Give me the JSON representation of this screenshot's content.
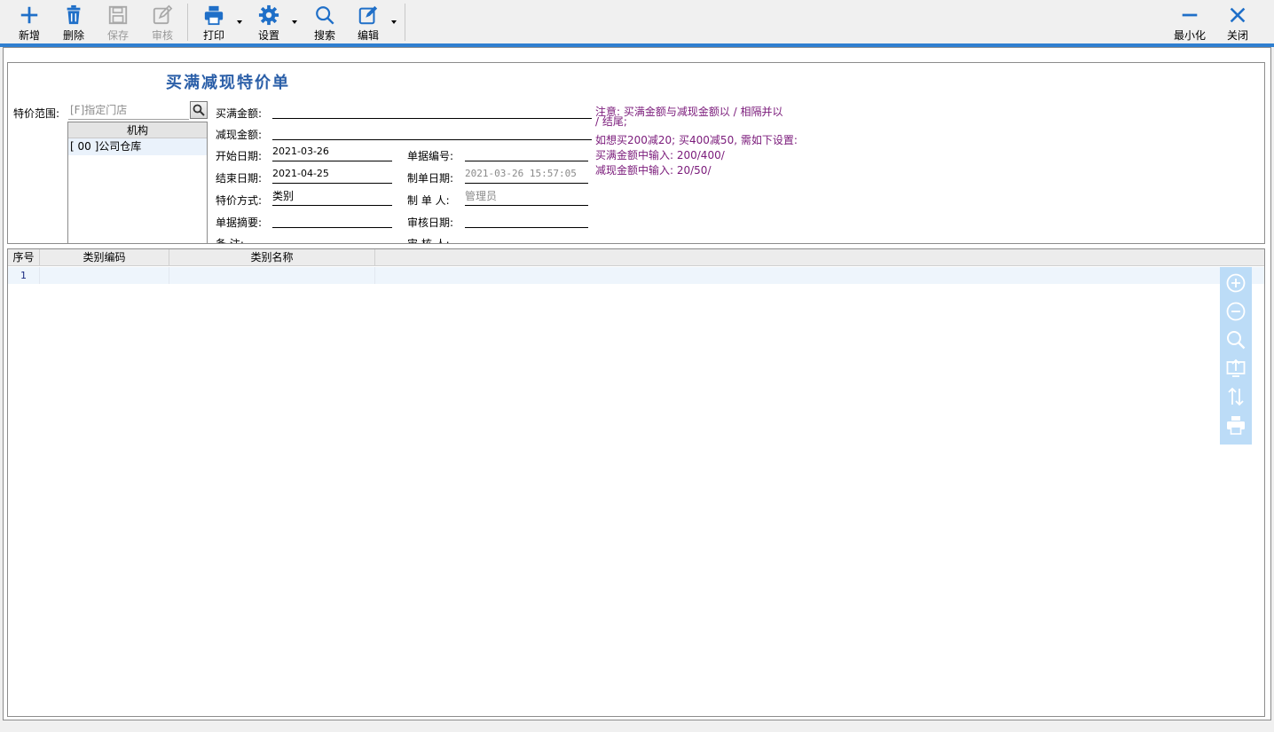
{
  "toolbar": {
    "buttons": [
      {
        "label": "新增",
        "icon": "plus-icon",
        "enabled": true
      },
      {
        "label": "删除",
        "icon": "trash-icon",
        "enabled": true
      },
      {
        "label": "保存",
        "icon": "save-icon",
        "enabled": false
      },
      {
        "label": "审核",
        "icon": "edit-check-icon",
        "enabled": false
      },
      {
        "label": "打印",
        "icon": "printer-icon",
        "enabled": true
      },
      {
        "label": "设置",
        "icon": "gear-icon",
        "enabled": true
      },
      {
        "label": "搜索",
        "icon": "search-icon",
        "enabled": true
      },
      {
        "label": "编辑",
        "icon": "edit-icon",
        "enabled": true
      }
    ],
    "minimize_label": "最小化",
    "close_label": "关闭"
  },
  "colors": {
    "accent": "#2f7fd0",
    "icon_blue": "#1f6fc8",
    "title_blue": "#2b5fa8",
    "note_purple": "#7a1a7a"
  },
  "form": {
    "title": "买满减现特价单",
    "scope_label": "特价范围:",
    "scope_placeholder": "[F]指定门店",
    "org_header": "机构",
    "org_row": "[ 00 ]公司仓库",
    "buy_amount_label": "买满金额:",
    "buy_amount_value": "",
    "reduce_amount_label": "减现金额:",
    "reduce_amount_value": "",
    "start_date_label": "开始日期:",
    "start_date_value": "2021-03-26",
    "end_date_label": "结束日期:",
    "end_date_value": "2021-04-25",
    "method_label": "特价方式:",
    "method_value": "类别",
    "summary_label": "单据摘要:",
    "summary_value": "",
    "remark_label": "备    注:",
    "doc_no_label": "单据编号:",
    "doc_no_value": "",
    "create_date_label": "制单日期:",
    "create_date_value": "2021-03-26 15:57:05",
    "creator_label": "制 单 人:",
    "creator_value": "管理员",
    "audit_date_label": "审核日期:",
    "audit_date_value": "",
    "auditor_label": "审 核 人:",
    "notes": [
      "注意: 买满金额与减现金额以 / 相隔并以",
      "/ 结尾;",
      "如想买200减20; 买400减50, 需如下设置:",
      "买满金额中输入: 200/400/",
      "减现金额中输入: 20/50/"
    ]
  },
  "grid": {
    "columns": [
      "序号",
      "类别编码",
      "类别名称"
    ],
    "rows": [
      {
        "index": "1",
        "code": "",
        "name": ""
      }
    ],
    "side_tools": [
      "zoom-in-icon",
      "zoom-out-icon",
      "search-icon",
      "export-icon",
      "sort-icon",
      "printer-icon"
    ]
  }
}
